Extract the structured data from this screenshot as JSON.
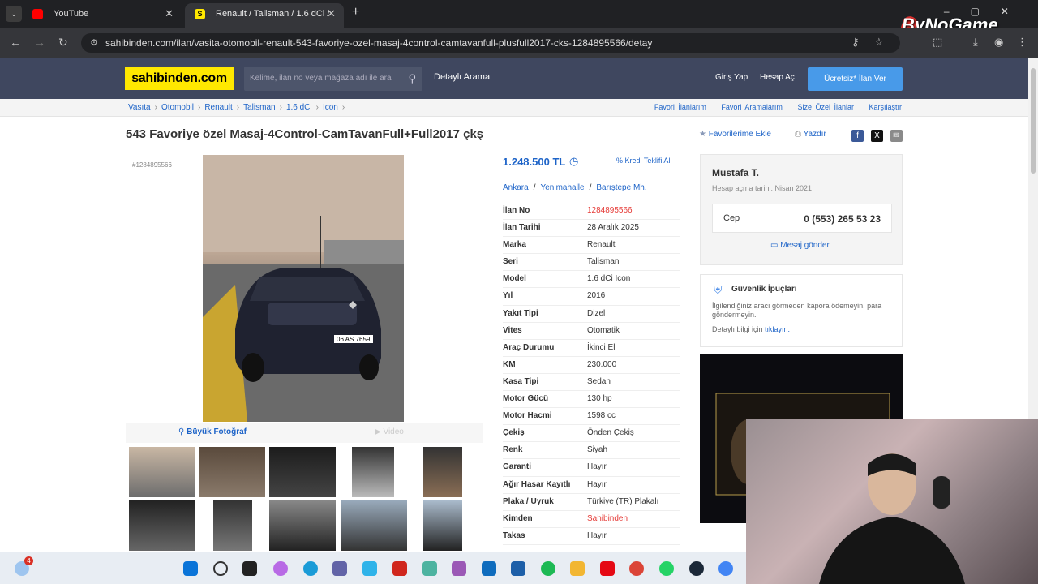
{
  "browser": {
    "tabs": [
      {
        "label": "YouTube",
        "active": false
      },
      {
        "label": "Renault / Talisman / 1.6 dCi / Ic",
        "active": true
      }
    ],
    "url": "sahibinden.com/ilan/vasita-otomobil-renault-543-favoriye-ozel-masaj-4control-camtavanfull-plusfull2017-cks-1284895566/detay",
    "watermark": "ByNoGame"
  },
  "header": {
    "logo": "sahibinden.com",
    "search_placeholder": "Kelime, ilan no veya mağaza adı ile ara",
    "detailed_search": "Detaylı Arama",
    "login": "Giriş Yap",
    "signup": "Hesap Aç",
    "post_ad": "Ücretsiz* İlan Ver"
  },
  "breadcrumb": [
    "Vasıta",
    "Otomobil",
    "Renault",
    "Talisman",
    "1.6 dCi",
    "Icon"
  ],
  "quick_links": [
    "Favori İlanlarım",
    "Favori Aramalarım",
    "Size Özel İlanlar",
    "Karşılaştır"
  ],
  "listing": {
    "title": "543 Favoriye özel Masaj-4Control-CamTavanFull+Full2017 çkş",
    "add_favorite": "Favorilerime Ekle",
    "print": "Yazdır",
    "listing_no_tag": "#1284895566",
    "big_photo": "Büyük Fotoğraf",
    "video": "Video",
    "price": "1.248.500 TL",
    "credit_offer": "Kredi Teklifi Al",
    "location": [
      "Ankara",
      "Yenimahalle",
      "Barıştepe Mh."
    ],
    "specs": [
      {
        "key": "İlan No",
        "value": "1284895566",
        "highlight": true
      },
      {
        "key": "İlan Tarihi",
        "value": "28 Aralık 2025"
      },
      {
        "key": "Marka",
        "value": "Renault"
      },
      {
        "key": "Seri",
        "value": "Talisman"
      },
      {
        "key": "Model",
        "value": "1.6 dCi Icon"
      },
      {
        "key": "Yıl",
        "value": "2016"
      },
      {
        "key": "Yakıt Tipi",
        "value": "Dizel"
      },
      {
        "key": "Vites",
        "value": "Otomatik"
      },
      {
        "key": "Araç Durumu",
        "value": "İkinci El"
      },
      {
        "key": "KM",
        "value": "230.000"
      },
      {
        "key": "Kasa Tipi",
        "value": "Sedan"
      },
      {
        "key": "Motor Gücü",
        "value": "130 hp"
      },
      {
        "key": "Motor Hacmi",
        "value": "1598 cc"
      },
      {
        "key": "Çekiş",
        "value": "Önden Çekiş"
      },
      {
        "key": "Renk",
        "value": "Siyah"
      },
      {
        "key": "Garanti",
        "value": "Hayır"
      },
      {
        "key": "Ağır Hasar Kayıtlı",
        "value": "Hayır"
      },
      {
        "key": "Plaka / Uyruk",
        "value": "Türkiye (TR) Plakalı"
      },
      {
        "key": "Kimden",
        "value": "Sahibinden",
        "highlight": true
      },
      {
        "key": "Takas",
        "value": "Hayır"
      }
    ],
    "plate": "06 AS 7659"
  },
  "seller": {
    "name": "Mustafa T.",
    "since": "Hesap açma tarihi: Nisan 2021",
    "phone_label": "Cep",
    "phone": "0 (553) 265 53 23",
    "message": "Mesaj gönder"
  },
  "safety": {
    "title": "Güvenlik İpuçları",
    "text": "İlgilendiğiniz aracı görmeden kapora ödemeyin, para göndermeyin.",
    "detail_prefix": "Detaylı bilgi için",
    "detail_link": "tıklayın."
  },
  "taskbar": {
    "weather_badge": "4"
  },
  "colors": {
    "brand": "#ffe800",
    "header": "#3f475f",
    "link": "#1e64c8",
    "cta": "#489ae9",
    "highlight": "#e53935"
  }
}
